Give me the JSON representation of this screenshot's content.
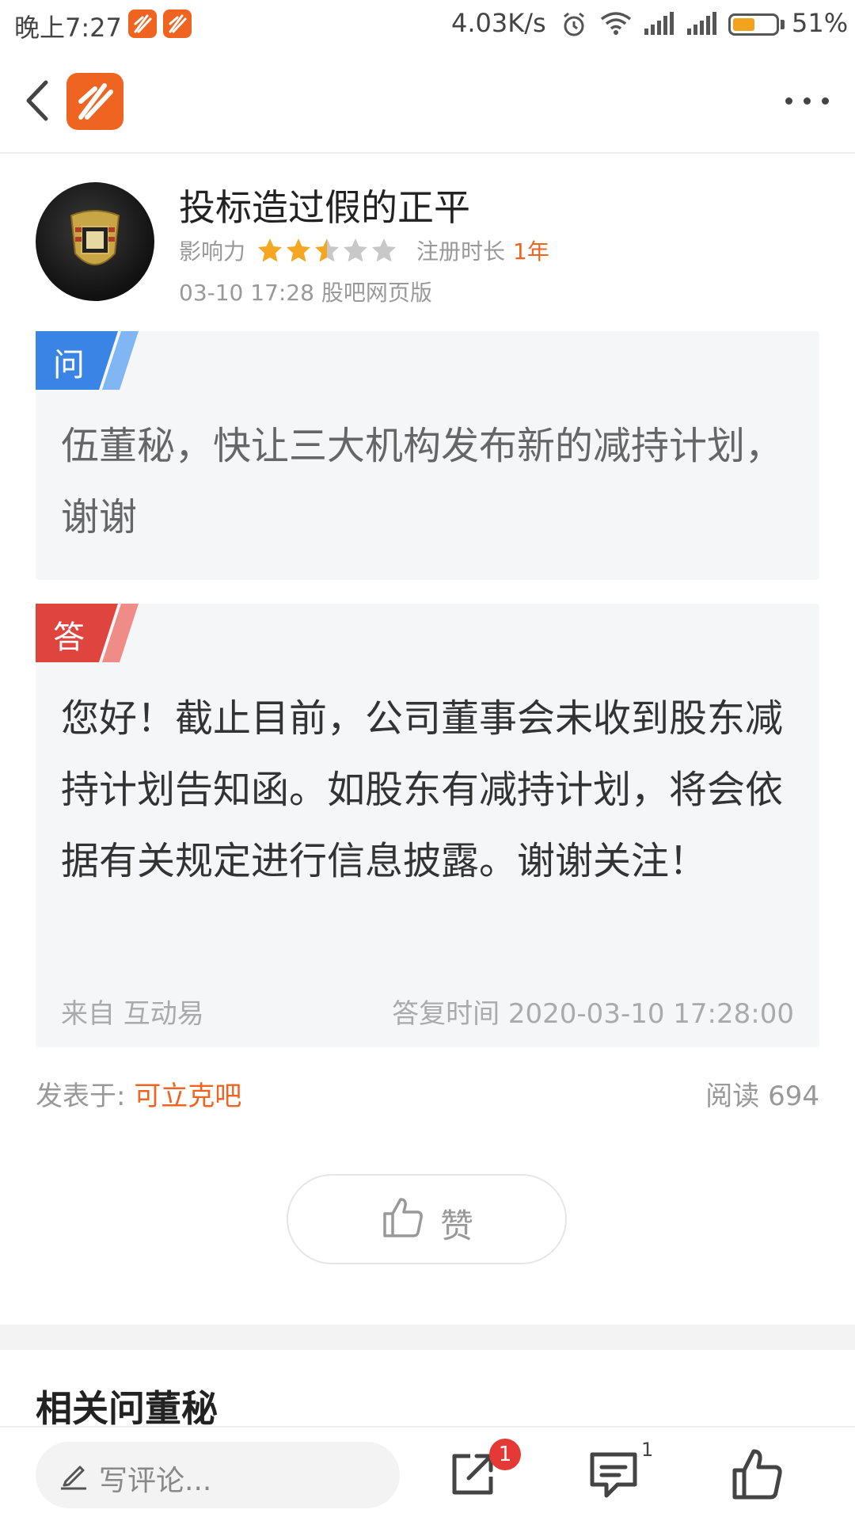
{
  "status_bar": {
    "time": "晚上7:27",
    "network_speed": "4.03K/s",
    "battery": "51%",
    "battery_level": 0.51,
    "icons": [
      "app-notification-icon",
      "app-notification-icon",
      "alarm-icon",
      "wifi-icon",
      "signal-icon",
      "signal-icon",
      "battery-icon"
    ]
  },
  "header": {
    "back_icon": "back-arrow-icon",
    "logo_icon": "app-logo-icon",
    "more_icon": "more-dots-icon"
  },
  "author": {
    "name": "投标造过假的正平",
    "influence_label": "影响力",
    "influence_stars": 2.5,
    "influence_max": 5,
    "reg_label": "注册时长",
    "reg_value": "1年",
    "post_meta": "03-10 17:28 股吧网页版"
  },
  "question": {
    "tag": "问",
    "text": "伍董秘，快让三大机构发布新的减持计划，谢谢"
  },
  "answer": {
    "tag": "答",
    "text": "您好！截止目前，公司董事会未收到股东减持计划告知函。如股东有减持计划，将会依据有关规定进行信息披露。谢谢关注！",
    "source": "来自 互动易",
    "reply_time": "答复时间 2020-03-10 17:28:00"
  },
  "footer_meta": {
    "posted_label": "发表于:",
    "bar_name": "可立克吧",
    "reads": "阅读 694"
  },
  "like_button": {
    "label": "赞"
  },
  "related_title": "相关问董秘",
  "bottom_bar": {
    "comment_placeholder": "写评论...",
    "share_badge": "1",
    "comment_count": "1"
  },
  "colors": {
    "accent": "#ee6420",
    "question_tag": "#3a84e6",
    "answer_tag": "#e0443f",
    "badge": "#e53935"
  }
}
